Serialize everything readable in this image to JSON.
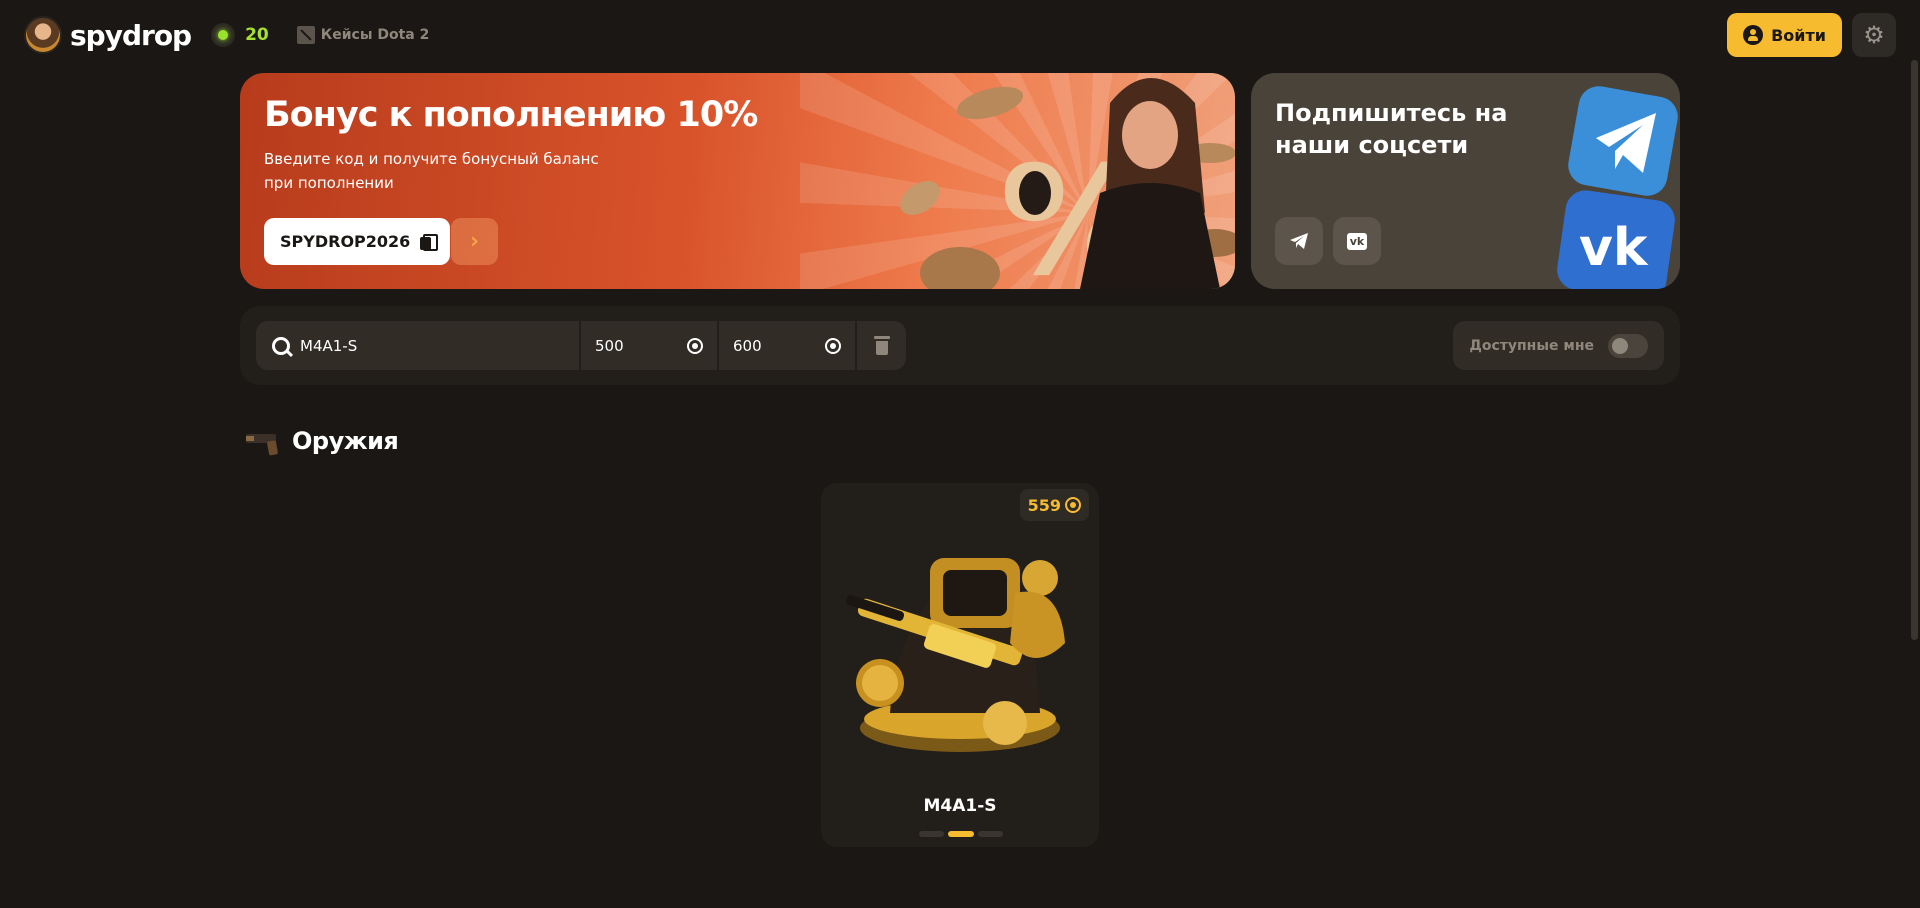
{
  "header": {
    "brand": "spydrop",
    "online_count": "20",
    "nav_link": "Кейсы Dota 2",
    "login_label": "Войти"
  },
  "promo_banner": {
    "title": "Бонус к пополнению 10%",
    "subtitle": "Введите код и получите бонусный баланс при пополнении",
    "code": "SPYDROP2026"
  },
  "social_banner": {
    "title": "Подпишитесь на наши соцсети",
    "vk_label": "vk"
  },
  "filters": {
    "search_value": "M4A1-S",
    "price_min": "500",
    "price_max": "600",
    "available_label": "Доступные мне",
    "available_on": false
  },
  "section": {
    "title": "Оружия"
  },
  "items": [
    {
      "name": "M4A1-S",
      "price": "559",
      "carousel_active_index": 1,
      "carousel_count": 3
    }
  ],
  "colors": {
    "background": "#1a1714",
    "accent": "#f7bb2f",
    "online": "#9be22d",
    "promo": "#d9532a"
  }
}
